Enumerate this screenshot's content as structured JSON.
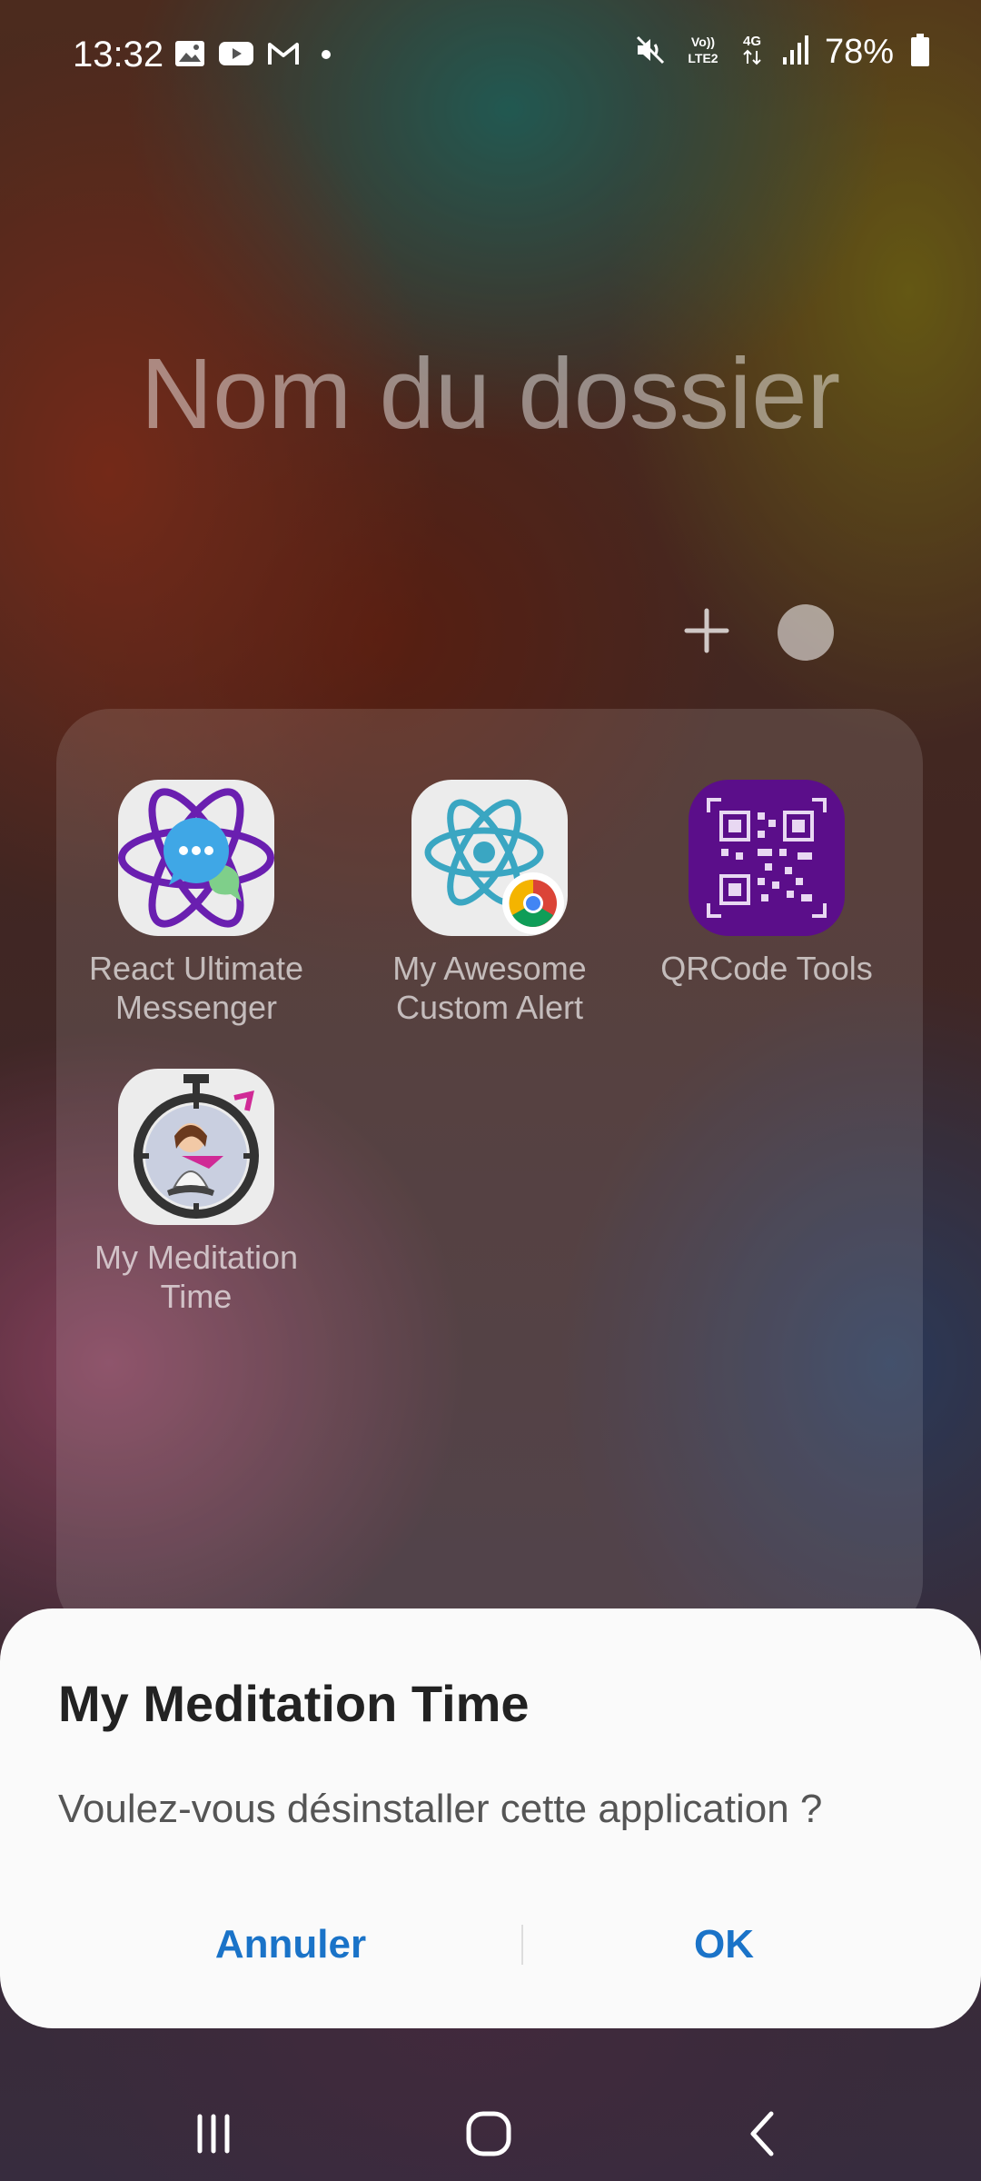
{
  "status_bar": {
    "time": "13:32",
    "icons_left": [
      "image-icon",
      "youtube-icon",
      "gmail-icon",
      "dot-icon"
    ],
    "icons_right": [
      "mute-icon",
      "volte-icon",
      "4g-icon",
      "signal-icon"
    ],
    "volte_label": "Vo)) LTE2",
    "network_label": "4G",
    "battery_percent": "78%"
  },
  "folder": {
    "title": "Nom du dossier",
    "add_symbol": "+",
    "apps": [
      {
        "label": "React Ultimate Messenger",
        "icon": "react-messenger-icon"
      },
      {
        "label": "My Awesome Custom Alert",
        "icon": "react-chrome-icon"
      },
      {
        "label": "QRCode Tools",
        "icon": "qrcode-icon"
      },
      {
        "label": "My Meditation Time",
        "icon": "meditation-icon"
      }
    ]
  },
  "dialog": {
    "title": "My Meditation Time",
    "message": "Voulez-vous désinstaller cette application ?",
    "cancel_label": "Annuler",
    "ok_label": "OK",
    "accent_color": "#1a73c8"
  },
  "nav": {
    "recents": "recents-icon",
    "home": "home-icon",
    "back": "back-icon"
  }
}
